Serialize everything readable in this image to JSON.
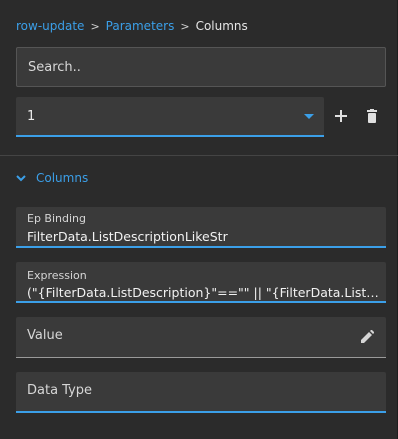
{
  "breadcrumb": {
    "items": [
      "row-update",
      "Parameters",
      "Columns"
    ],
    "separator": ">"
  },
  "search": {
    "placeholder": "Search.."
  },
  "selector": {
    "value": "1"
  },
  "section": {
    "title": "Columns"
  },
  "fields": {
    "ep_binding": {
      "label": "Ep Binding",
      "value": "FilterData.ListDescriptionLikeStr"
    },
    "expression": {
      "label": "Expression",
      "value": "(\"{FilterData.ListDescription}\"==\"\" || \"{FilterData.ListDescription}\"==null) ? null : \"%{FilterData.ListDescription}%\""
    },
    "value": {
      "label": "Value"
    },
    "data_type": {
      "label": "Data Type"
    }
  },
  "icons": {
    "add": "plus-icon",
    "delete": "trash-icon",
    "edit": "pencil-icon",
    "caret": "caret-down-icon",
    "section_toggle": "chevron-down-icon"
  },
  "colors": {
    "accent": "#3b9fe8",
    "background": "#2b2b2b",
    "field": "#3a3a3a"
  }
}
